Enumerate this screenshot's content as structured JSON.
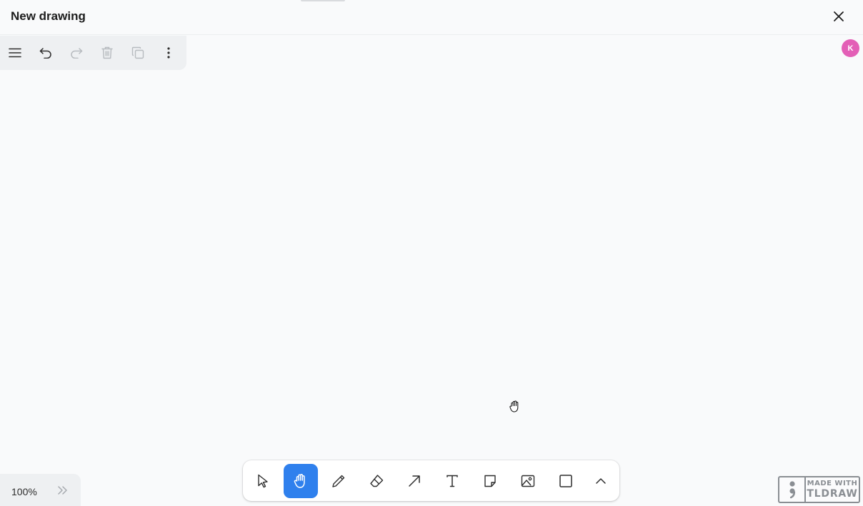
{
  "header": {
    "title": "New drawing",
    "close_icon": "close-icon"
  },
  "menu": {
    "items": [
      {
        "name": "main-menu",
        "icon": "hamburger-icon",
        "enabled": true
      },
      {
        "name": "undo",
        "icon": "undo-icon",
        "enabled": true
      },
      {
        "name": "redo",
        "icon": "redo-icon",
        "enabled": false
      },
      {
        "name": "delete",
        "icon": "trash-icon",
        "enabled": false
      },
      {
        "name": "duplicate",
        "icon": "duplicate-icon",
        "enabled": false
      },
      {
        "name": "more",
        "icon": "more-vertical-icon",
        "enabled": true
      }
    ]
  },
  "user": {
    "avatar_initial": "K",
    "avatar_color": "#e35fb6"
  },
  "zoom": {
    "level": "100%"
  },
  "toolbar": {
    "active_tool": "hand",
    "active_color": "#2f80ed",
    "tools": [
      "select",
      "hand",
      "draw",
      "eraser",
      "arrow",
      "text",
      "note",
      "asset",
      "rectangle",
      "more"
    ]
  },
  "badge": {
    "line1": "MADE WITH",
    "line2": "TLDRAW"
  }
}
